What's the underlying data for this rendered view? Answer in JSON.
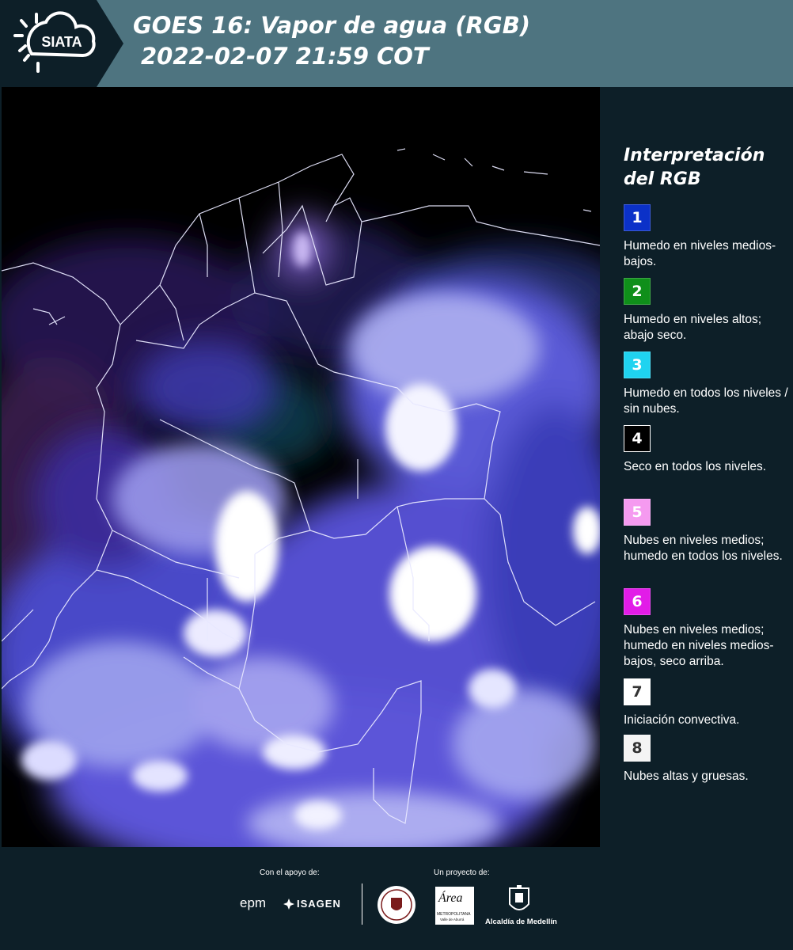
{
  "header": {
    "logo_text": "SIATA",
    "title_line1": "GOES 16: Vapor de agua (RGB)",
    "title_line2": "2022-02-07 21:59 COT"
  },
  "legend": {
    "title": "Interpretación del RGB",
    "items": [
      {
        "number": "1",
        "text": "Humedo en niveles medios-bajos.",
        "color": "#0b31c8",
        "text_color": "#ffffff"
      },
      {
        "number": "2",
        "text": "Humedo en niveles altos; abajo seco.",
        "color": "#0f8f1a",
        "text_color": "#ffffff"
      },
      {
        "number": "3",
        "text": "Humedo en todos los niveles / sin nubes.",
        "color": "#1fd3f0",
        "text_color": "#ffffff"
      },
      {
        "number": "4",
        "text": "Seco en todos los niveles.",
        "color": "#000000",
        "text_color": "#ffffff"
      },
      {
        "number": "5",
        "text": "Nubes en niveles medios; humedo en todos los niveles.",
        "color": "#f59af0",
        "text_color": "#ffffff"
      },
      {
        "number": "6",
        "text": "Nubes en niveles medios; humedo en niveles medios-bajos, seco arriba.",
        "color": "#e21ce8",
        "text_color": "#ffffff"
      },
      {
        "number": "7",
        "text": "Iniciación convectiva.",
        "color": "#ffffff",
        "text_color": "#333333"
      },
      {
        "number": "8",
        "text": "Nubes altas y gruesas.",
        "color": "#f4f4f4",
        "text_color": "#333333"
      }
    ]
  },
  "footer": {
    "support_caption": "Con el apoyo de:",
    "project_caption": "Un proyecto de:",
    "logos": {
      "epm": "epm",
      "isagen": "ISAGEN",
      "area_top": "Área",
      "area_sub": "METROPOLITANA",
      "area_sub2": "Valle de Aburrá",
      "alcaldia": "Alcaldía de Medellín"
    }
  }
}
